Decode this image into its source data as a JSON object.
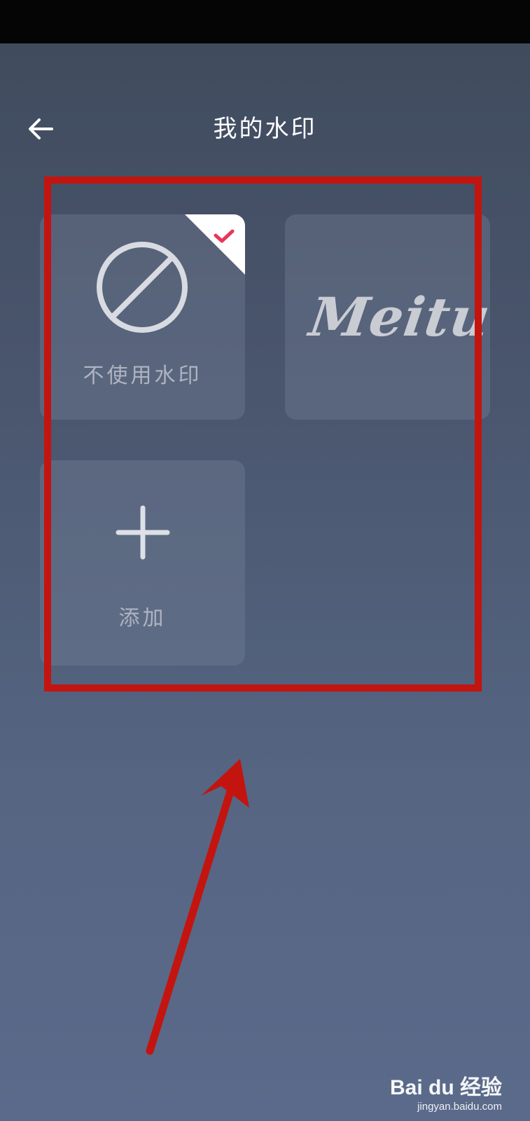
{
  "header": {
    "title": "我的水印",
    "back_icon": "arrow-left-icon"
  },
  "watermarks": {
    "items": [
      {
        "label": "不使用水印",
        "icon": "no-entry-icon",
        "selected": true
      },
      {
        "logo_text": "Meitu",
        "icon": "meitu-logo",
        "selected": false
      },
      {
        "label": "添加",
        "icon": "plus-icon",
        "selected": false
      }
    ],
    "selected_check_color": "#e8365a"
  },
  "annotation": {
    "frame_color": "#c4140f",
    "arrow_color": "#c4140f"
  },
  "watermark_site": {
    "brand": "Bai du 经验",
    "url": "jingyan.baidu.com"
  }
}
